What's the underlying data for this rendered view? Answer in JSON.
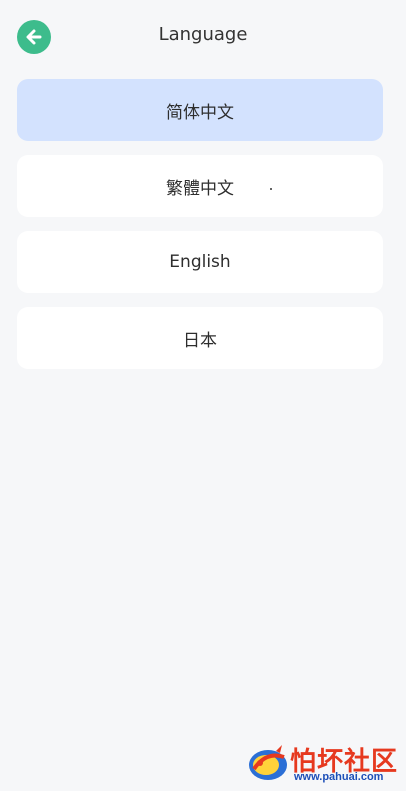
{
  "header": {
    "title": "Language",
    "back_icon": "arrow-left-icon"
  },
  "languages": [
    {
      "label": "简体中文",
      "selected": true
    },
    {
      "label": "繁體中文",
      "selected": false
    },
    {
      "label": "English",
      "selected": false
    },
    {
      "label": "日本",
      "selected": false
    }
  ],
  "watermark": {
    "title": "怕坏社区",
    "url": "www.pahuai.com"
  },
  "colors": {
    "accent": "#3dbc8c",
    "selected_bg": "#d3e2fe",
    "background": "#f6f7f9",
    "watermark_red": "#e6391f",
    "watermark_blue": "#1d4fb8"
  }
}
